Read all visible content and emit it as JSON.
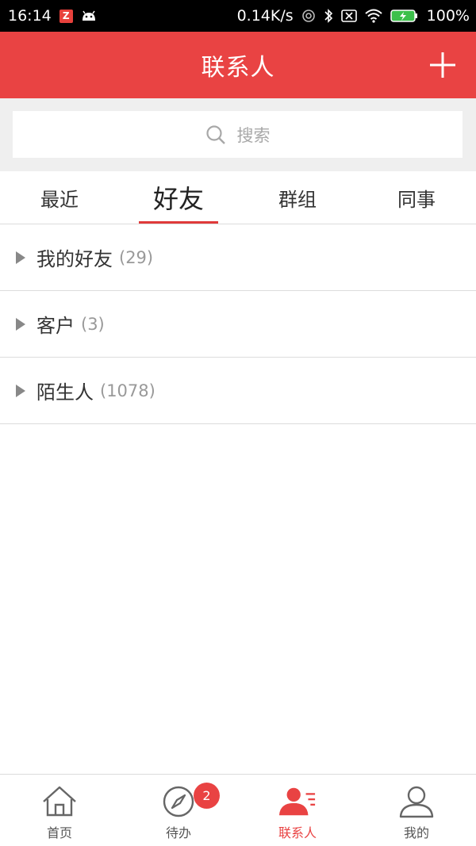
{
  "status_bar": {
    "time": "16:14",
    "z_badge": "Z",
    "speed": "0.14K/s",
    "battery": "100%"
  },
  "header": {
    "title": "联系人"
  },
  "search": {
    "placeholder": "搜索"
  },
  "tabs": [
    {
      "label": "最近"
    },
    {
      "label": "好友"
    },
    {
      "label": "群组"
    },
    {
      "label": "同事"
    }
  ],
  "groups": [
    {
      "name": "我的好友",
      "count": "(29)"
    },
    {
      "name": "客户",
      "count": "(3)"
    },
    {
      "name": "陌生人",
      "count": "(1078)"
    }
  ],
  "bottom_nav": [
    {
      "label": "首页",
      "icon": "home-icon"
    },
    {
      "label": "待办",
      "icon": "compass-icon",
      "badge": "2"
    },
    {
      "label": "联系人",
      "icon": "contacts-icon"
    },
    {
      "label": "我的",
      "icon": "user-icon"
    }
  ],
  "colors": {
    "accent": "#e94343",
    "divider": "#dcdcdc"
  }
}
